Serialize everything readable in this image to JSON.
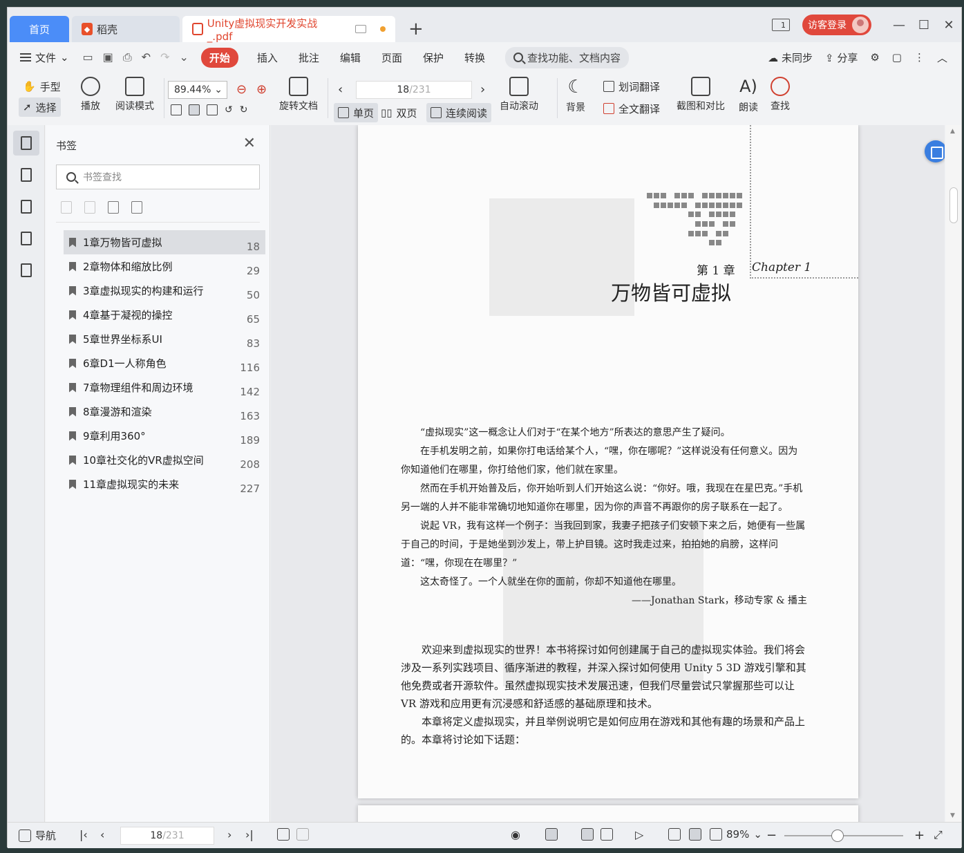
{
  "tabs": {
    "home": "首页",
    "daoke": "稻壳",
    "document": "Unity虚拟现实开发实战_.pdf"
  },
  "titlebar": {
    "layout_number": "1",
    "login": "访客登录"
  },
  "menu": {
    "file": "文件",
    "start": "开始",
    "insert": "插入",
    "annotate": "批注",
    "edit": "编辑",
    "page": "页面",
    "protect": "保护",
    "convert": "转换",
    "search_placeholder": "查找功能、文档内容",
    "sync": "未同步",
    "share": "分享"
  },
  "toolbar": {
    "hand": "手型",
    "select": "选择",
    "play": "播放",
    "read_mode": "阅读模式",
    "zoom": "89.44%",
    "rotate": "旋转文档",
    "single": "单页",
    "double": "双页",
    "continuous": "连续阅读",
    "current_page": "18",
    "total_pages": "/231",
    "auto_scroll": "自动滚动",
    "background": "背景",
    "word_translate": "划词翻译",
    "full_translate": "全文翻译",
    "screenshot_compare": "截图和对比",
    "read_aloud": "朗读",
    "find": "查找"
  },
  "sidebar": {
    "title": "书签",
    "search_placeholder": "书签查找",
    "bookmarks": [
      {
        "label": "1章万物皆可虚拟",
        "page": "18"
      },
      {
        "label": "2章物体和缩放比例",
        "page": "29"
      },
      {
        "label": "3章虚拟现实的构建和运行",
        "page": "50"
      },
      {
        "label": "4章基于凝视的操控",
        "page": "65"
      },
      {
        "label": "5章世界坐标系UI",
        "page": "83"
      },
      {
        "label": "6章D1一人称角色",
        "page": "116"
      },
      {
        "label": "7章物理组件和周边环境",
        "page": "142"
      },
      {
        "label": "8章漫游和渲染",
        "page": "163"
      },
      {
        "label": "9章利用360°",
        "page": "189"
      },
      {
        "label": "10章社交化的VR虚拟空间",
        "page": "208"
      },
      {
        "label": "11章虚拟现实的未来",
        "page": "227"
      }
    ]
  },
  "document": {
    "chapter_number": "第 1 章",
    "chapter_en": "Chapter 1",
    "chapter_title": "万物皆可虚拟",
    "quote_p1": "“虚拟现实”这一概念让人们对于“在某个地方”所表达的意思产生了疑问。",
    "quote_p2": "在手机发明之前，如果你打电话给某个人，“嘿，你在哪呢？”这样说没有任何意义。因为你知道他们在哪里，你打给他们家，他们就在家里。",
    "quote_p3": "然而在手机开始普及后，你开始听到人们开始这么说：“你好。哦，我现在在星巴克。”手机另一端的人并不能非常确切地知道你在哪里，因为你的声音不再跟你的房子联系在一起了。",
    "quote_p4": "说起 VR，我有这样一个例子：当我回到家，我妻子把孩子们安顿下来之后，她便有一些属于自己的时间，于是她坐到沙发上，带上护目镜。这时我走过来，拍拍她的肩膀，这样问道：“嘿，你现在在哪里？”",
    "quote_p5": "这太奇怪了。一个人就坐在你的面前，你却不知道他在哪里。",
    "attribution": "——Jonathan Stark，移动专家 & 播主",
    "body_p1": "欢迎来到虚拟现实的世界！本书将探讨如何创建属于自己的虚拟现实体验。我们将会涉及一系列实践项目、循序渐进的教程，并深入探讨如何使用 Unity 5 3D 游戏引擎和其他免费或者开源软件。虽然虚拟现实技术发展迅速，但我们尽量尝试只掌握那些可以让 VR 游戏和应用更有沉浸感和舒适感的基础原理和技术。",
    "body_p2": "本章将定义虚拟现实，并且举例说明它是如何应用在游戏和其他有趣的场景和产品上的。本章将讨论如下话题："
  },
  "statusbar": {
    "nav": "导航",
    "current_page": "18",
    "total_pages": "/231",
    "zoom": "89%"
  }
}
